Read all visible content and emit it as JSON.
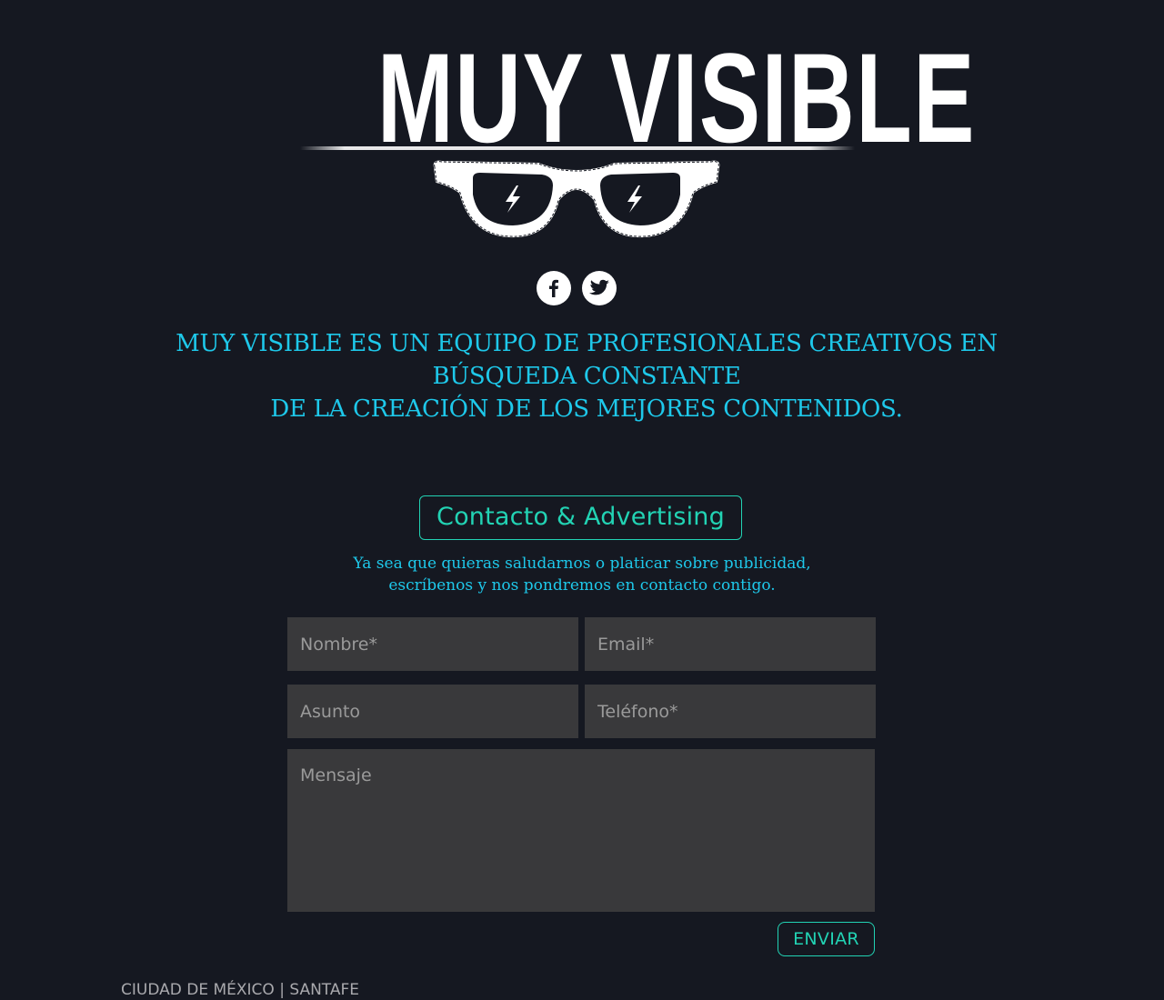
{
  "logo": {
    "text": "MUY VISIBLE"
  },
  "social": {
    "facebook_icon": "facebook-icon",
    "twitter_icon": "twitter-icon"
  },
  "tagline": {
    "line1": "MUY VISIBLE ES UN EQUIPO DE PROFESIONALES CREATIVOS EN",
    "line2": "BÚSQUEDA CONSTANTE",
    "line3": "DE LA CREACIÓN DE LOS MEJORES CONTENIDOS."
  },
  "contact": {
    "title": "Contacto & Advertising",
    "desc_line1": "Ya sea que quieras saludarnos o platicar sobre publicidad,",
    "desc_line2": "escríbenos y nos pondremos en contacto contigo."
  },
  "form": {
    "nombre_placeholder": "Nombre*",
    "email_placeholder": "Email*",
    "asunto_placeholder": "Asunto",
    "telefono_placeholder": "Teléfono*",
    "mensaje_placeholder": "Mensaje",
    "nombre_value": "",
    "email_value": "",
    "asunto_value": "",
    "telefono_value": "",
    "mensaje_value": "",
    "send_label": "ENVIAR"
  },
  "footer": {
    "location": "CIUDAD DE MÉXICO | SANTAFE"
  },
  "colors": {
    "background": "#151821",
    "accent_cyan": "#1ec8ea",
    "accent_teal": "#22d3b4",
    "field_bg": "#39393b",
    "footer_text": "#a9a9ad"
  }
}
